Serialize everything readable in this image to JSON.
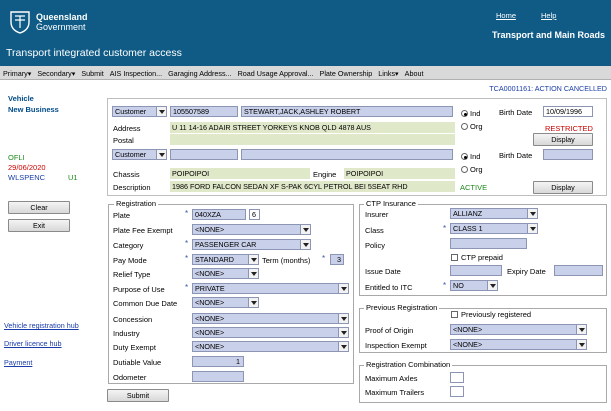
{
  "header": {
    "logo_line1": "Queensland",
    "logo_line2": "Government",
    "app_title": "Transport integrated customer access",
    "department": "Transport and Main Roads",
    "home_link": "Home",
    "help_link": "Help"
  },
  "menu": [
    "Primary▾",
    "Secondary▾",
    "Submit",
    "AIS Inspection...",
    "Garaging Address...",
    "Road Usage Approval...",
    "Plate Ownership",
    "Links▾",
    "About"
  ],
  "status_message": "TCA0001161: ACTION CANCELLED",
  "left": {
    "title1": "Vehicle",
    "title2": "New Business",
    "office": "OFLI",
    "date": "29/06/2020",
    "user": "WLSPENC",
    "user_level": "U1",
    "clear_button": "Clear",
    "exit_button": "Exit",
    "links": [
      "Vehicle registration hub",
      "Driver licence hub",
      "Payment"
    ]
  },
  "customer1": {
    "type": "Customer",
    "number": "105507589",
    "name": "STEWART,JACK,ASHLEY ROBERT",
    "ind_label": "Ind",
    "org_label": "Org",
    "birth_date_label": "Birth Date",
    "birth_date": "10/09/1996",
    "address_label": "Address",
    "address": "U 11 14-16 ADAIR STREET YORKEYS KNOB QLD 4878 AUS",
    "restricted": "RESTRICTED",
    "postal_label": "Postal",
    "postal": "",
    "display_button": "Display"
  },
  "customer2": {
    "type": "Customer",
    "number": "",
    "name": "",
    "ind_label": "Ind",
    "org_label": "Org",
    "birth_date_label": "Birth Date",
    "birth_date": ""
  },
  "vehicle": {
    "chassis_label": "Chassis",
    "chassis": "POIPOIPOI",
    "engine_label": "Engine",
    "engine": "POIPOIPOI",
    "description_label": "Description",
    "description": "1986 FORD FALCON SEDAN XF S-PAK 6CYL PETROL BEI 5SEAT RHD",
    "status": "ACTIVE",
    "display_button": "Display"
  },
  "registration": {
    "legend": "Registration",
    "plate_label": "Plate",
    "plate": "040XZA",
    "plate_suffix": "6",
    "plate_fee_exempt_label": "Plate Fee Exempt",
    "plate_fee_exempt": "<NONE>",
    "category_label": "Category",
    "category": "PASSENGER CAR",
    "pay_mode_label": "Pay Mode",
    "pay_mode": "STANDARD",
    "term_label": "Term (months)",
    "term": "3",
    "relief_type_label": "Relief Type",
    "relief_type": "<NONE>",
    "purpose_label": "Purpose of Use",
    "purpose": "PRIVATE",
    "common_due_label": "Common Due Date",
    "common_due": "<NONE>",
    "concession_label": "Concession",
    "concession": "<NONE>",
    "industry_label": "Industry",
    "industry": "<NONE>",
    "duty_exempt_label": "Duty Exempt",
    "duty_exempt": "<NONE>",
    "dutiable_value_label": "Dutiable Value",
    "dutiable_value": "1",
    "odometer_label": "Odometer",
    "odometer": ""
  },
  "ctp": {
    "legend": "CTP Insurance",
    "insurer_label": "Insurer",
    "insurer": "ALLIANZ",
    "class_label": "Class",
    "class": "CLASS 1",
    "policy_label": "Policy",
    "policy": "",
    "ctp_prepaid_label": "CTP prepaid",
    "issue_date_label": "Issue Date",
    "issue_date": "",
    "expiry_date_label": "Expiry Date",
    "expiry_date": "",
    "itc_label": "Entitled to ITC",
    "itc": "NO"
  },
  "previous_registration": {
    "legend": "Previous Registration",
    "previously_registered_label": "Previously registered",
    "proof_label": "Proof of Origin",
    "proof": "<NONE>",
    "inspection_exempt_label": "Inspection Exempt",
    "inspection_exempt": "<NONE>"
  },
  "combination": {
    "legend": "Registration Combination",
    "max_axles_label": "Maximum Axles",
    "max_axles": "",
    "max_trailers_label": "Maximum Trailers",
    "max_trailers": ""
  },
  "submit_button": "Submit"
}
